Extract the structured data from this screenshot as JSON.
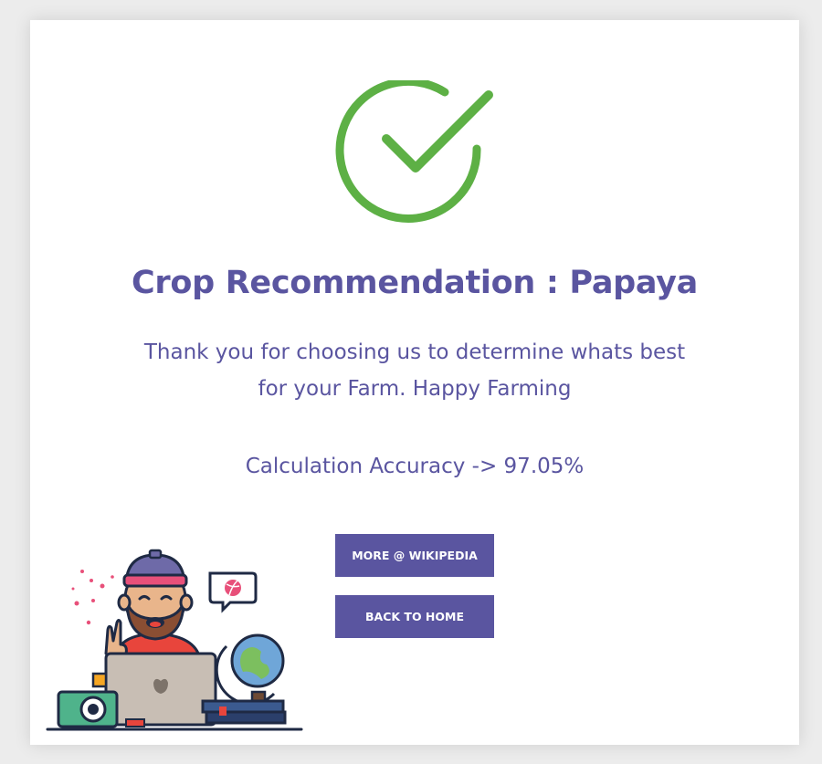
{
  "result": {
    "title": "Crop Recommendation : Papaya",
    "message": "Thank you for choosing us to determine whats best for your Farm. Happy Farming",
    "accuracy": "Calculation Accuracy -> 97.05%"
  },
  "actions": {
    "wikipedia_label": "MORE @ WIKIPEDIA",
    "home_label": "BACK TO HOME"
  },
  "icons": {
    "success": "check-circle-icon",
    "illustration": "farmer-at-laptop-illustration"
  },
  "colors": {
    "accent": "#5a55a0",
    "success": "#5db045",
    "background": "#ececec",
    "card": "#ffffff"
  }
}
